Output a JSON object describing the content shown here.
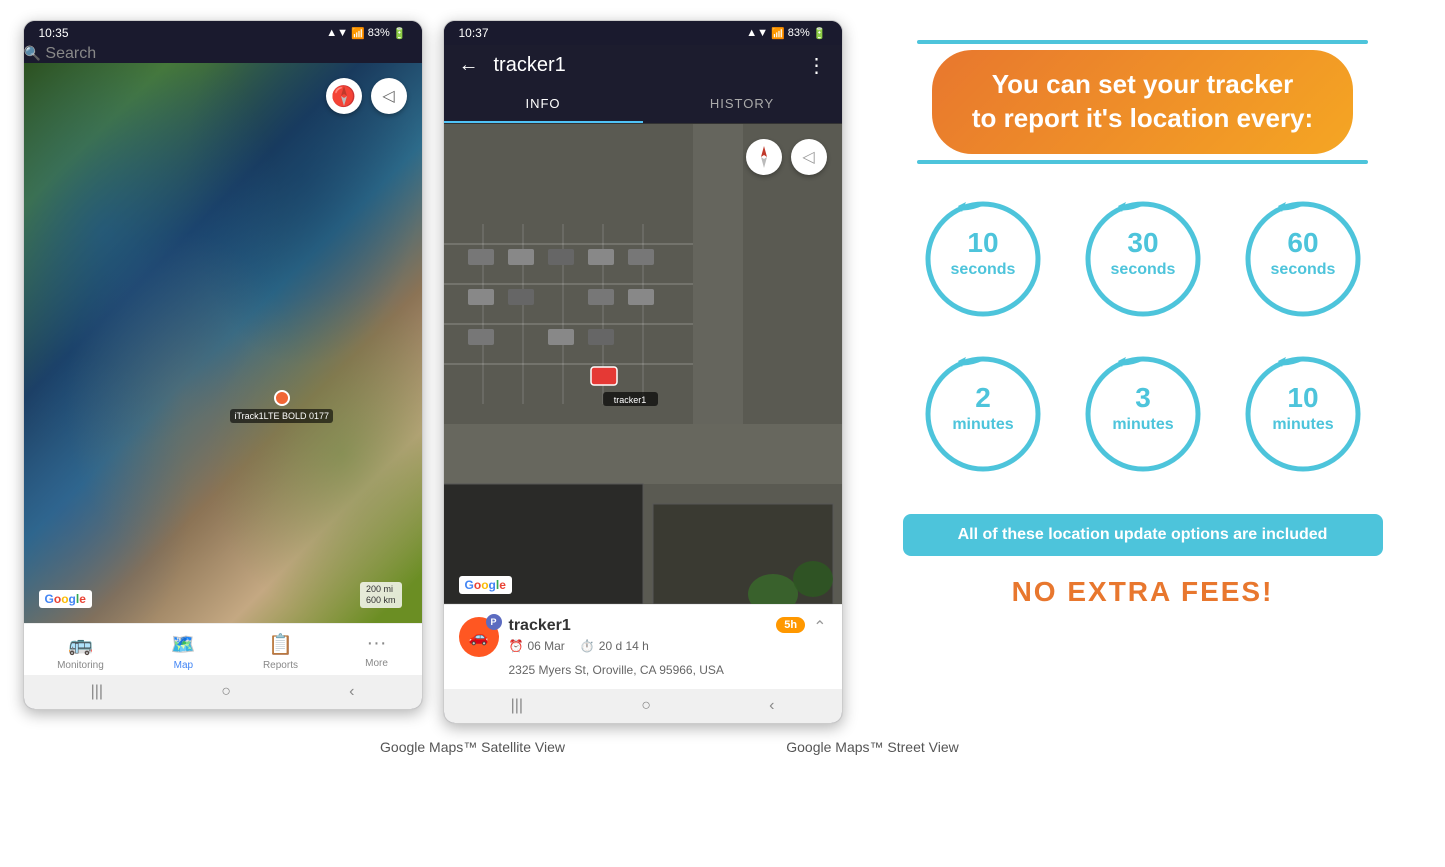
{
  "phone1": {
    "status_bar": {
      "time": "10:35",
      "signal": "▲▼ .ll 83%"
    },
    "search": {
      "placeholder": "Search"
    },
    "compass": "🧭",
    "tracker_label": "iTrack1LTE BOLD 0177",
    "google_logo": "Google",
    "scale_bar": "200 mi\n600 km",
    "nav_items": [
      {
        "label": "Monitoring",
        "icon": "🚌",
        "active": false
      },
      {
        "label": "Map",
        "icon": "📍",
        "active": true
      },
      {
        "label": "Reports",
        "icon": "📊",
        "active": false
      },
      {
        "label": "More",
        "icon": "···",
        "active": false
      }
    ],
    "caption": "Google Maps™ Satellite View"
  },
  "phone2": {
    "status_bar": {
      "time": "10:37",
      "signal": "▲▼ .ll 83%"
    },
    "tracker_name": "tracker1",
    "tabs": [
      {
        "label": "INFO",
        "active": true
      },
      {
        "label": "HISTORY",
        "active": false
      }
    ],
    "tracker_info": {
      "name": "tracker1",
      "date": "06 Mar",
      "duration": "20 d 14 h",
      "time_badge": "5h",
      "address": "2325 Myers St, Oroville, CA 95966, USA",
      "tracker_pin_label": "tracker1"
    },
    "google_logo": "Google",
    "caption": "Google Maps™ Street View"
  },
  "info_panel": {
    "title": "You can set your tracker\nto report it's location every:",
    "circles": [
      {
        "number": "10",
        "unit": "seconds"
      },
      {
        "number": "30",
        "unit": "seconds"
      },
      {
        "number": "60",
        "unit": "seconds"
      },
      {
        "number": "2",
        "unit": "minutes"
      },
      {
        "number": "3",
        "unit": "minutes"
      },
      {
        "number": "10",
        "unit": "minutes"
      }
    ],
    "banner_text": "All of these location update options are included",
    "no_fee_text": "NO EXTRA FEES!"
  }
}
